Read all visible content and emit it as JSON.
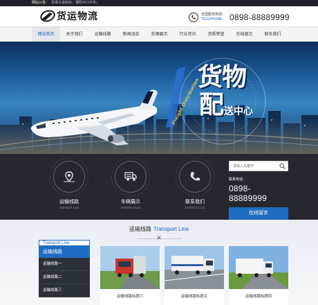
{
  "notice": {
    "label": "网站公告：",
    "text": "市场众说纷纭，谨防众口不实。"
  },
  "brand": {
    "logo_text": "货运物流"
  },
  "hotline": {
    "label": "全国服务热线：",
    "en": "TELEPHONE",
    "number": "0898-88889999"
  },
  "nav": {
    "items": [
      "网站首页",
      "关于我们",
      "运输线路",
      "新闻动态",
      "车辆展示",
      "行业资讯",
      "资质荣誉",
      "在线留言",
      "联系我们"
    ],
    "active_index": 0
  },
  "banner": {
    "line1": "货物",
    "line2": "配",
    "line3": "送中心",
    "ribbon": "Freight Distribution"
  },
  "services": [
    {
      "title": "运输线路",
      "en": "Transport Line",
      "icon": "route-pin-icon"
    },
    {
      "title": "车辆展示",
      "en": "Vehicles Show",
      "icon": "truck-icon"
    },
    {
      "title": "联系我们",
      "en": "CONTACT US",
      "icon": "phone-icon"
    }
  ],
  "search": {
    "placeholder": "请输入关键字"
  },
  "contact": {
    "label": "联系电话：",
    "number": "0898-88889999",
    "button": "在线留言"
  },
  "section": {
    "title_cn": "运输线路",
    "title_en": "Transport Line",
    "divider_icon": "close-x-icon"
  },
  "category": {
    "header_en": "Transport Line",
    "header_cn": "运输线路",
    "items": [
      "运输线路一",
      "运输线路二",
      "运输线路三"
    ]
  },
  "cards": [
    {
      "caption": "运输线路标题六"
    },
    {
      "caption": "运输线路标题五"
    },
    {
      "caption": "运输线路标题四"
    }
  ],
  "colors": {
    "accent": "#1e6cc0",
    "dark": "#25292f",
    "topbar": "#1e2127"
  }
}
